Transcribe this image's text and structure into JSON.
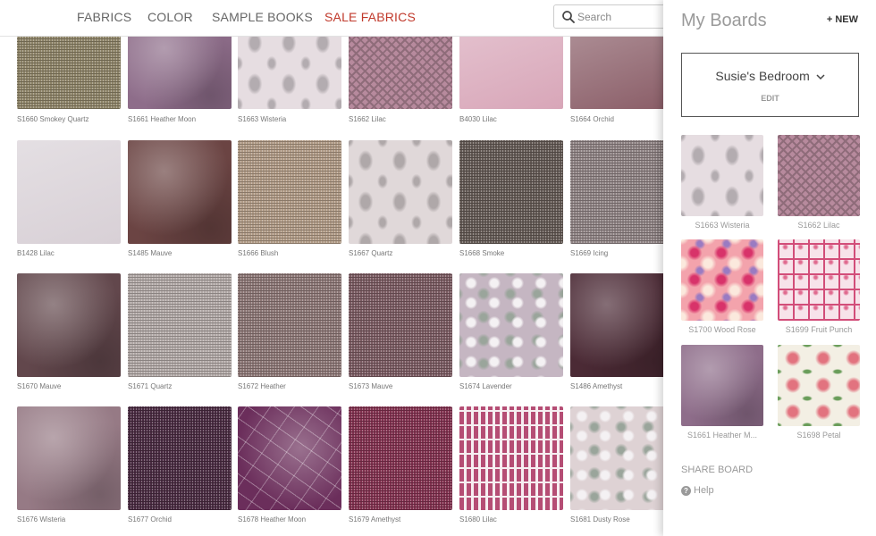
{
  "nav": {
    "links": [
      {
        "label": "FABRICS"
      },
      {
        "label": "COLOR"
      },
      {
        "label": "SAMPLE BOOKS"
      },
      {
        "label": "SALE FABRICS"
      }
    ],
    "search_placeholder": "Search"
  },
  "fabrics": [
    {
      "label": "S1660 Smokey Quartz",
      "color": "#8e8468",
      "pattern": "weave"
    },
    {
      "label": "S1661 Heather Moon",
      "color": "#8e6d8a",
      "pattern": "velvet"
    },
    {
      "label": "S1663 Wisteria",
      "color": "#e6dde1",
      "pattern": "damask"
    },
    {
      "label": "S1662 Lilac",
      "color": "#b78a9d",
      "pattern": "lattice"
    },
    {
      "label": "B4030 Lilac",
      "color": "#d8a6b8",
      "pattern": "plain"
    },
    {
      "label": "S1664 Orchid",
      "color": "#8a5d67",
      "pattern": "plain"
    },
    {
      "label": "B1428 Lilac",
      "color": "#d8d0d6",
      "pattern": "plain"
    },
    {
      "label": "S1485 Mauve",
      "color": "#6b4443",
      "pattern": "velvet"
    },
    {
      "label": "S1666 Blush",
      "color": "#b09a85",
      "pattern": "weave"
    },
    {
      "label": "S1667 Quartz",
      "color": "#e0d8d9",
      "pattern": "damask"
    },
    {
      "label": "S1668 Smoke",
      "color": "#645a55",
      "pattern": "weave"
    },
    {
      "label": "S1669 Icing",
      "color": "#8f8384",
      "pattern": "weave"
    },
    {
      "label": "S1670 Mauve",
      "color": "#62474c",
      "pattern": "velvet"
    },
    {
      "label": "S1671 Quartz",
      "color": "#b1a8a6",
      "pattern": "weave"
    },
    {
      "label": "S1672 Heather",
      "color": "#8d7776",
      "pattern": "weave"
    },
    {
      "label": "S1673 Mauve",
      "color": "#7b5b62",
      "pattern": "weave"
    },
    {
      "label": "S1674 Lavender",
      "color": "#c5b6c2",
      "pattern": "toile"
    },
    {
      "label": "S1486 Amethyst",
      "color": "#4b2a35",
      "pattern": "velvet"
    },
    {
      "label": "S1676 Wisteria",
      "color": "#967a85",
      "pattern": "velvet"
    },
    {
      "label": "S1677 Orchid",
      "color": "#4a2b42",
      "pattern": "weave"
    },
    {
      "label": "S1678 Heather Moon",
      "color": "#6b2e5b",
      "pattern": "cracked"
    },
    {
      "label": "S1679 Amethyst",
      "color": "#82314f",
      "pattern": "weave"
    },
    {
      "label": "S1680 Lilac",
      "color": "#b54d74",
      "pattern": "feather"
    },
    {
      "label": "S1681 Dusty Rose",
      "color": "#ded2d4",
      "pattern": "toile"
    }
  ],
  "boards": {
    "title": "My Boards",
    "new_label": "+ NEW",
    "current_board": "Susie's Bedroom",
    "edit_label": "EDIT",
    "items": [
      {
        "label": "S1663 Wisteria",
        "color": "#e6dde1",
        "pattern": "damask"
      },
      {
        "label": "S1662 Lilac",
        "color": "#b78a9d",
        "pattern": "lattice"
      },
      {
        "label": "S1700 Wood Rose",
        "color": "#f3a3ac",
        "pattern": "floral"
      },
      {
        "label": "S1699 Fruit Punch",
        "color": "#f7e3ea",
        "pattern": "trellis"
      },
      {
        "label": "S1661 Heather M...",
        "color": "#8e6d8a",
        "pattern": "velvet"
      },
      {
        "label": "S1698 Petal",
        "color": "#f3efe4",
        "pattern": "vine"
      }
    ],
    "share_label": "SHARE BOARD",
    "help_label": "Help"
  }
}
